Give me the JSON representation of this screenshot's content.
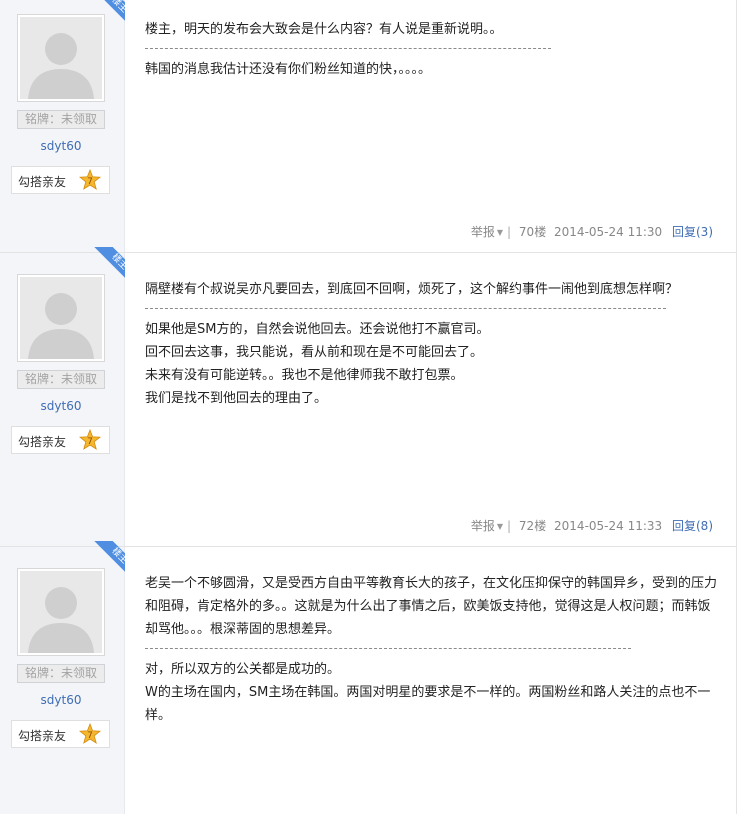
{
  "posts": [
    {
      "louzhu_badge": "楼主",
      "medal": "铭牌：未领取",
      "username": "sdyt60",
      "buddy_label": "勾搭亲友",
      "level": "7",
      "quote": "楼主，明天的发布会大致会是什么内容？有人说是重新说明。。",
      "dashes": "----------------------------------------------------------------------------------------",
      "reply_lines": [
        "韩国的消息我估计还没有你们粉丝知道的快，。。。。"
      ],
      "report": "举报",
      "floor": "70楼",
      "time": "2014-05-24 11:30",
      "reply_link": "回复(3)"
    },
    {
      "louzhu_badge": "楼主",
      "medal": "铭牌：未领取",
      "username": "sdyt60",
      "buddy_label": "勾搭亲友",
      "level": "7",
      "quote": "隔壁楼有个叔说吴亦凡要回去，到底回不回啊，烦死了，这个解约事件一闹他到底想怎样啊？",
      "dashes": "-------------------------------------------------------------------------------------------------------------",
      "reply_lines": [
        "如果他是SM方的，自然会说他回去。还会说他打不赢官司。",
        "回不回去这事，我只能说，看从前和现在是不可能回去了。",
        "未来有没有可能逆转。。我也不是他律师我不敢打包票。",
        "我们是找不到他回去的理由了。"
      ],
      "report": "举报",
      "floor": "72楼",
      "time": "2014-05-24 11:33",
      "reply_link": "回复(8)"
    },
    {
      "louzhu_badge": "楼主",
      "medal": "铭牌：未领取",
      "username": "sdyt60",
      "buddy_label": "勾搭亲友",
      "level": "7",
      "quote": "老吴一个不够圆滑，又是受西方自由平等教育长大的孩子，在文化压抑保守的韩国异乡，受到的压力和阻碍，肯定格外的多。。这就是为什么出了事情之后，欧美饭支持他，觉得这是人权问题；而韩饭却骂他。。。根深蒂固的思想差异。",
      "dashes": "----------------------------------------------------------------------------------------------------",
      "reply_lines": [
        "对，所以双方的公关都是成功的。",
        "W的主场在国内，SM主场在韩国。两国对明星的要求是不一样的。两国粉丝和路人关注的点也不一样。"
      ],
      "report": "",
      "floor": "",
      "time": "",
      "reply_link": ""
    }
  ]
}
